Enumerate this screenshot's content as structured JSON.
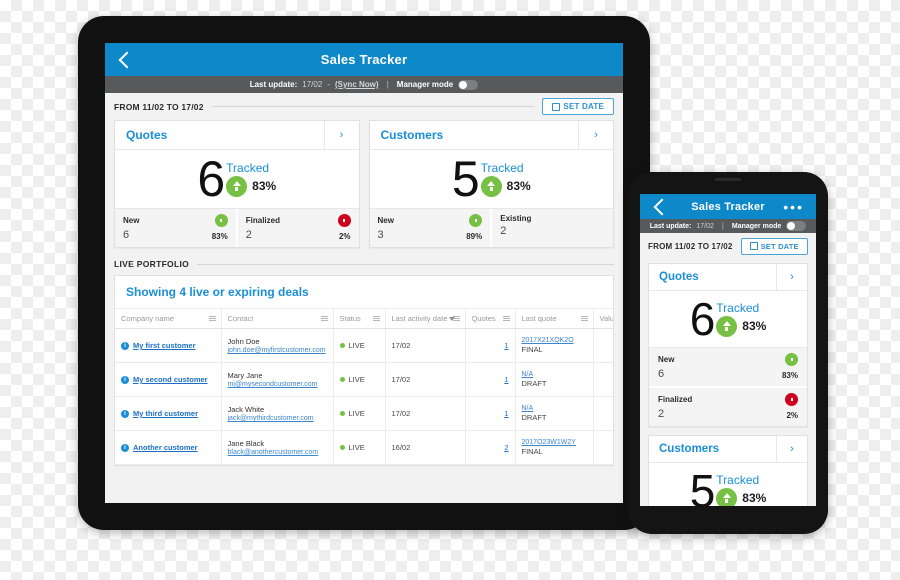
{
  "app": {
    "title": "Sales Tracker",
    "back_icon": "back-chevron-icon",
    "overflow_icon": "more-options-icon"
  },
  "statusbar": {
    "last_update_label": "Last update:",
    "last_update_value": "17/02",
    "dash": "-",
    "sync_label": "(Sync Now)",
    "separator": "|",
    "manager_mode_label": "Manager mode",
    "toggle_state": "off"
  },
  "daterange": {
    "label": "FROM 11/02 TO 17/02",
    "set_date_button": "SET DATE",
    "calendar_icon": "calendar-icon"
  },
  "cards": [
    {
      "title": "Quotes",
      "chevron": "›",
      "big_number": "6",
      "tracked_label": "Tracked",
      "tracked_pct": "83%",
      "tracked_direction": "up",
      "footer": [
        {
          "name": "New",
          "value": "6",
          "pct": "83%",
          "direction": "up"
        },
        {
          "name": "Finalized",
          "value": "2",
          "pct": "2%",
          "direction": "down"
        }
      ]
    },
    {
      "title": "Customers",
      "chevron": "›",
      "big_number": "5",
      "tracked_label": "Tracked",
      "tracked_pct": "83%",
      "tracked_direction": "up",
      "footer": [
        {
          "name": "New",
          "value": "3",
          "pct": "89%",
          "direction": "up"
        },
        {
          "name": "Existing",
          "value": "2",
          "pct": "",
          "direction": "none"
        }
      ]
    }
  ],
  "portfolio": {
    "section_label": "LIVE PORTFOLIO",
    "panel_title": "Showing 4 live or expiring deals",
    "columns": [
      {
        "label": "Company name",
        "sorted": false
      },
      {
        "label": "Contact",
        "sorted": false
      },
      {
        "label": "Status",
        "sorted": false
      },
      {
        "label": "Last activity date",
        "sorted": true
      },
      {
        "label": "Quotes",
        "sorted": false
      },
      {
        "label": "Last quote",
        "sorted": false
      },
      {
        "label": "Value",
        "sorted": false
      }
    ],
    "rows": [
      {
        "company": "My first customer",
        "contact_name": "John Doe",
        "contact_email": "john.doe@myfirstcustomer.com",
        "status": "LIVE",
        "last_activity": "17/02",
        "quotes": "1",
        "last_quote_ref": "2017X21XQK2O",
        "last_quote_state": "FINAL"
      },
      {
        "company": "My second customer",
        "contact_name": "Mary Jane",
        "contact_email": "mj@mysecondcustomer.com",
        "status": "LIVE",
        "last_activity": "17/02",
        "quotes": "1",
        "last_quote_ref": "N/A",
        "last_quote_state": "DRAFT"
      },
      {
        "company": "My third customer",
        "contact_name": "Jack White",
        "contact_email": "jack@mythirdcustomer.com",
        "status": "LIVE",
        "last_activity": "17/02",
        "quotes": "1",
        "last_quote_ref": "N/A",
        "last_quote_state": "DRAFT"
      },
      {
        "company": "Another customer",
        "contact_name": "Jane Black",
        "contact_email": "black@anothercustomer.com",
        "status": "LIVE",
        "last_activity": "16/02",
        "quotes": "2",
        "last_quote_ref": "2017O23W1W2Y",
        "last_quote_state": "FINAL"
      }
    ]
  },
  "phone": {
    "statusbar": {
      "last_update_label": "Last update:",
      "last_update_value": "17/02",
      "separator": "|",
      "manager_mode_label": "Manager mode"
    }
  },
  "colors": {
    "brand_blue": "#0d88c8",
    "link_blue": "#1a8fd8",
    "status_gray": "#58595b",
    "up_green": "#76c043",
    "down_red": "#d0021b",
    "screen_bg": "#f2f2f2",
    "device_black": "#141414"
  }
}
